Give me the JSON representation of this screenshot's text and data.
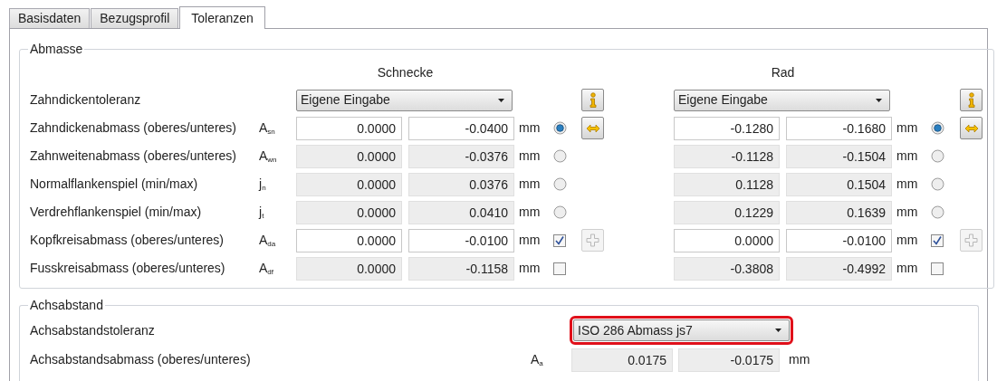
{
  "tabs": [
    {
      "label": "Basisdaten",
      "selected": false
    },
    {
      "label": "Bezugsprofil",
      "selected": false
    },
    {
      "label": "Toleranzen",
      "selected": true
    }
  ],
  "abmasse": {
    "title": "Abmasse",
    "columns": [
      "Schnecke",
      "Rad"
    ],
    "tolerance_row": {
      "label": "Zahndickentoleranz",
      "selects": [
        {
          "value": "Eigene Eingabe",
          "button": {
            "kind": "info",
            "disabled": false
          }
        },
        {
          "value": "Eigene Eingabe",
          "button": {
            "kind": "info",
            "disabled": false
          }
        }
      ]
    },
    "rows": [
      {
        "label": "Zahndickenabmass (oberes/unteres)",
        "symbol": "A$_{sn}$",
        "sides": [
          {
            "values": [
              "0.0000",
              "-0.0400"
            ],
            "editable": true,
            "unit": "mm",
            "toggle": {
              "kind": "radio",
              "selected": true
            },
            "button": {
              "kind": "swap",
              "disabled": false
            }
          },
          {
            "values": [
              "-0.1280",
              "-0.1680"
            ],
            "editable": true,
            "unit": "mm",
            "toggle": {
              "kind": "radio",
              "selected": true
            },
            "button": {
              "kind": "swap",
              "disabled": false
            }
          }
        ]
      },
      {
        "label": "Zahnweitenabmass (oberes/unteres)",
        "symbol": "A$_{wn}$",
        "sides": [
          {
            "values": [
              "0.0000",
              "-0.0376"
            ],
            "editable": false,
            "unit": "mm",
            "toggle": {
              "kind": "radio",
              "selected": false
            }
          },
          {
            "values": [
              "-0.1128",
              "-0.1504"
            ],
            "editable": false,
            "unit": "mm",
            "toggle": {
              "kind": "radio",
              "selected": false
            }
          }
        ]
      },
      {
        "label": "Normalflankenspiel (min/max)",
        "symbol": "j$_{n}$",
        "sides": [
          {
            "values": [
              "0.0000",
              "0.0376"
            ],
            "editable": false,
            "unit": "mm",
            "toggle": {
              "kind": "radio",
              "selected": false
            }
          },
          {
            "values": [
              "0.1128",
              "0.1504"
            ],
            "editable": false,
            "unit": "mm",
            "toggle": {
              "kind": "radio",
              "selected": false
            }
          }
        ]
      },
      {
        "label": "Verdrehflankenspiel (min/max)",
        "symbol": "j$_{t}$",
        "sides": [
          {
            "values": [
              "0.0000",
              "0.0410"
            ],
            "editable": false,
            "unit": "mm",
            "toggle": {
              "kind": "radio",
              "selected": false
            }
          },
          {
            "values": [
              "0.1229",
              "0.1639"
            ],
            "editable": false,
            "unit": "mm",
            "toggle": {
              "kind": "radio",
              "selected": false
            }
          }
        ]
      },
      {
        "label": "Kopfkreisabmass (oberes/unteres)",
        "symbol": "A$_{da}$",
        "sides": [
          {
            "values": [
              "0.0000",
              "-0.0100"
            ],
            "editable": true,
            "unit": "mm",
            "toggle": {
              "kind": "checkbox",
              "checked": true
            },
            "button": {
              "kind": "plus",
              "disabled": true
            }
          },
          {
            "values": [
              "0.0000",
              "-0.0100"
            ],
            "editable": true,
            "unit": "mm",
            "toggle": {
              "kind": "checkbox",
              "checked": true
            },
            "button": {
              "kind": "plus",
              "disabled": true
            }
          }
        ]
      },
      {
        "label": "Fusskreisabmass (oberes/unteres)",
        "symbol": "A$_{df}$",
        "sides": [
          {
            "values": [
              "0.0000",
              "-0.1158"
            ],
            "editable": false,
            "unit": "mm",
            "toggle": {
              "kind": "checkbox",
              "checked": false
            }
          },
          {
            "values": [
              "-0.3808",
              "-0.4992"
            ],
            "editable": false,
            "unit": "mm",
            "toggle": {
              "kind": "checkbox",
              "checked": false
            }
          }
        ]
      }
    ]
  },
  "achsabstand": {
    "title": "Achsabstand",
    "tolerance": {
      "label": "Achsabstandstoleranz",
      "value": "ISO 286 Abmass js7",
      "highlighted": true
    },
    "deviation": {
      "label": "Achsabstandsabmass (oberes/unteres)",
      "symbol": "A$_{a}$",
      "values": [
        "0.0175",
        "-0.0175"
      ],
      "unit": "mm"
    }
  }
}
